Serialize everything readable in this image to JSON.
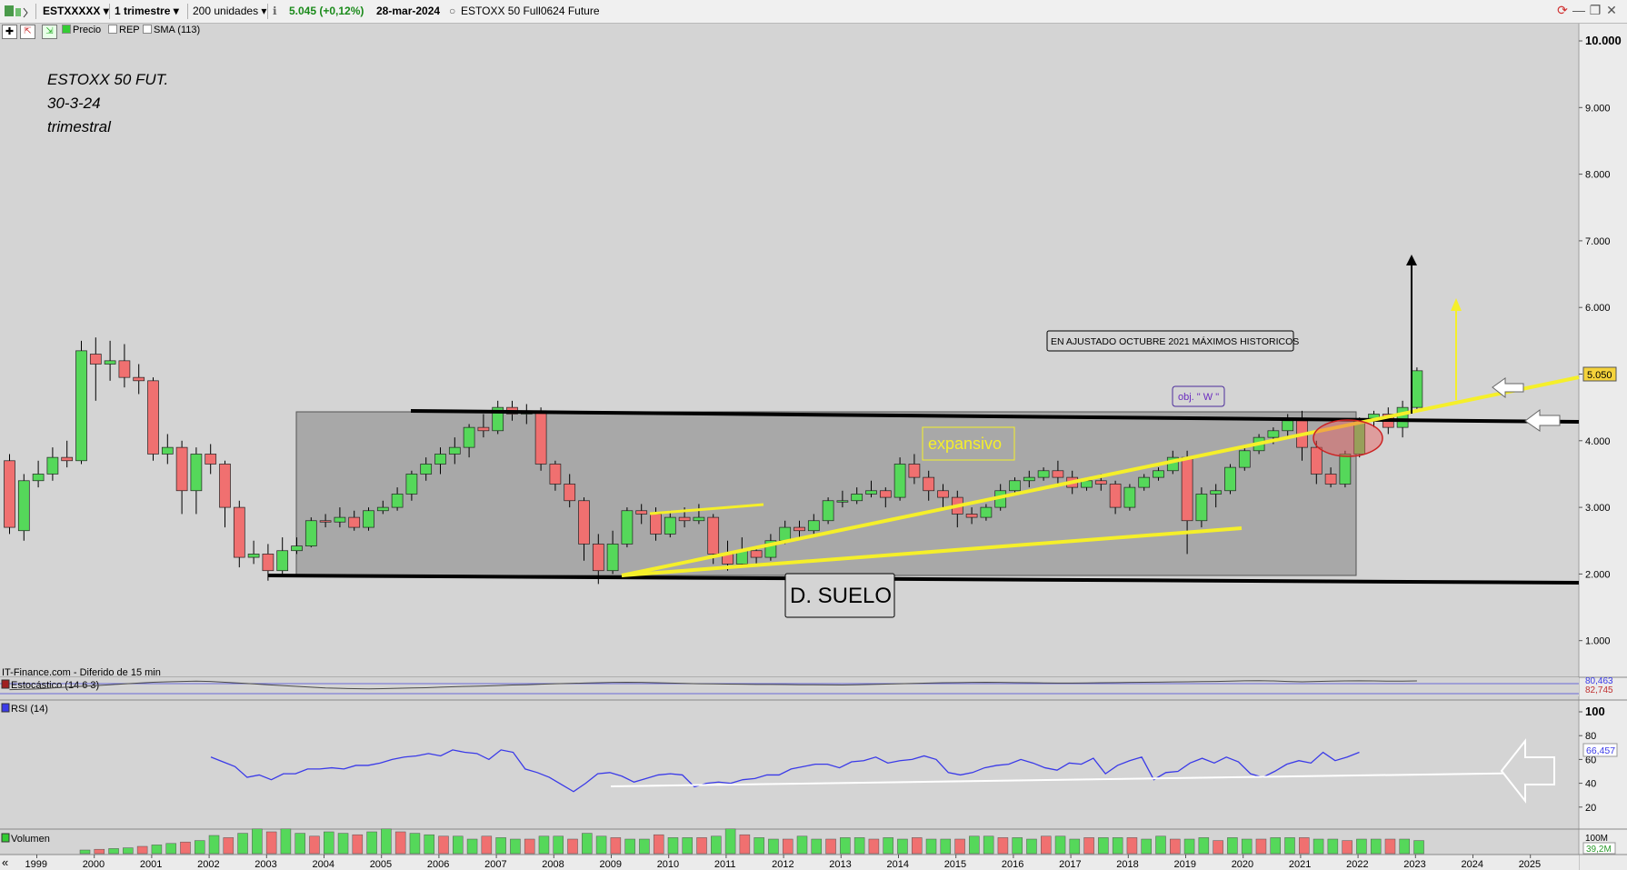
{
  "toolbar": {
    "symbol": "ESTXXXXX",
    "period": "1 trimestre",
    "units": "200 unidades",
    "info_icon": "info-icon",
    "quote": "5.045 (+0,12%)",
    "date": "28-mar-2024",
    "instrument": "ESTOXX 50 Full0624 Future",
    "refresh_icon": "refresh-icon",
    "minimize_icon": "minimize-icon",
    "restore_icon": "restore-icon",
    "close_icon": "close-icon"
  },
  "subbar": {
    "price_label": "Precio",
    "rep_label": "REP",
    "sma_label": "SMA (113)"
  },
  "annotation": {
    "line1": "ESTOXX 50 FUT.",
    "line2": "30-3-24",
    "line3": "trimestral"
  },
  "labels": {
    "maximos": "EN AJUSTADO OCTUBRE 2021 MÁXIMOS HISTORICOS",
    "obj_w": "obj. \" W \"",
    "expansivo": "expansivo",
    "suelo": "D. SUELO",
    "source": "IT-Finance.com - Diferido de 15 min",
    "last_price": "5.050",
    "stoch_label": "Estocástico (14 6 3)",
    "stoch_value": "82,745",
    "stoch_cut": "80,463",
    "rsi_label": "RSI (14)",
    "rsi_value": "66,457",
    "vol_label": "Volumen",
    "vol_max": "100M",
    "vol_value": "39,2M",
    "scroll_left": "«"
  },
  "colors": {
    "up": "#55d85a",
    "down": "#f07070",
    "yellow": "#f5ef2a",
    "rsi": "#3a3ae8"
  },
  "chart_data": {
    "type": "candlestick",
    "title": "ESTOXX 50 FUT.",
    "period": "quarterly",
    "ylim": [
      1000,
      10000
    ],
    "y_scale": "log",
    "y_ticks": [
      "10.000",
      "9.000",
      "8.000",
      "7.000",
      "6.000",
      "5.000",
      "4.000",
      "3.000",
      "2.000",
      "1.000"
    ],
    "x_ticks": [
      "1999",
      "2000",
      "2001",
      "2002",
      "2003",
      "2004",
      "2005",
      "2006",
      "2007",
      "2008",
      "2009",
      "2010",
      "2011",
      "2012",
      "2013",
      "2014",
      "2015",
      "2016",
      "2017",
      "2018",
      "2019",
      "2020",
      "2021",
      "2022",
      "2023",
      "2024",
      "2025"
    ],
    "candles": [
      [
        3700,
        2700,
        3800,
        2600
      ],
      [
        2650,
        3400,
        3500,
        2500
      ],
      [
        3400,
        3500,
        3700,
        3300
      ],
      [
        3500,
        3750,
        3900,
        3400
      ],
      [
        3750,
        3700,
        4000,
        3600
      ],
      [
        3700,
        5350,
        5500,
        3650
      ],
      [
        5300,
        5150,
        5550,
        4600
      ],
      [
        5150,
        5200,
        5500,
        4900
      ],
      [
        5200,
        4950,
        5450,
        4800
      ],
      [
        4950,
        4900,
        5150,
        4700
      ],
      [
        4900,
        3800,
        4950,
        3700
      ],
      [
        3800,
        3900,
        4100,
        3650
      ],
      [
        3900,
        3250,
        4000,
        2900
      ],
      [
        3250,
        3800,
        3900,
        2900
      ],
      [
        3800,
        3650,
        3950,
        3500
      ],
      [
        3650,
        3000,
        3700,
        2700
      ],
      [
        3000,
        2250,
        3100,
        2100
      ],
      [
        2250,
        2300,
        2500,
        2150
      ],
      [
        2300,
        2050,
        2450,
        1900
      ],
      [
        2050,
        2350,
        2550,
        2000
      ],
      [
        2350,
        2420,
        2550,
        2300
      ],
      [
        2420,
        2800,
        2850,
        2400
      ],
      [
        2800,
        2780,
        2900,
        2700
      ],
      [
        2780,
        2850,
        3000,
        2700
      ],
      [
        2850,
        2700,
        2950,
        2650
      ],
      [
        2700,
        2950,
        3000,
        2650
      ],
      [
        2950,
        3000,
        3100,
        2900
      ],
      [
        3000,
        3200,
        3300,
        2950
      ],
      [
        3200,
        3500,
        3550,
        3100
      ],
      [
        3500,
        3650,
        3750,
        3400
      ],
      [
        3650,
        3800,
        3900,
        3500
      ],
      [
        3800,
        3900,
        4050,
        3650
      ],
      [
        3900,
        4200,
        4250,
        3750
      ],
      [
        4200,
        4150,
        4400,
        4050
      ],
      [
        4150,
        4500,
        4600,
        4100
      ],
      [
        4500,
        4400,
        4600,
        4300
      ],
      [
        4400,
        4450,
        4550,
        4250
      ],
      [
        4450,
        3650,
        4500,
        3550
      ],
      [
        3650,
        3350,
        3700,
        3250
      ],
      [
        3350,
        3100,
        3500,
        3000
      ],
      [
        3100,
        2450,
        3150,
        2200
      ],
      [
        2450,
        2050,
        2600,
        1850
      ],
      [
        2050,
        2450,
        2650,
        2000
      ],
      [
        2450,
        2950,
        3000,
        2400
      ],
      [
        2950,
        2900,
        3050,
        2750
      ],
      [
        2900,
        2600,
        3000,
        2500
      ],
      [
        2600,
        2850,
        2950,
        2550
      ],
      [
        2850,
        2800,
        3000,
        2700
      ],
      [
        2800,
        2850,
        3050,
        2750
      ],
      [
        2850,
        2300,
        2900,
        2150
      ],
      [
        2300,
        2150,
        2500,
        2050
      ],
      [
        2150,
        2350,
        2550,
        2100
      ],
      [
        2350,
        2250,
        2400,
        2150
      ],
      [
        2250,
        2500,
        2600,
        2200
      ],
      [
        2500,
        2700,
        2800,
        2450
      ],
      [
        2700,
        2650,
        2800,
        2550
      ],
      [
        2650,
        2800,
        2900,
        2600
      ],
      [
        2800,
        3100,
        3150,
        2750
      ],
      [
        3100,
        3100,
        3250,
        3000
      ],
      [
        3100,
        3200,
        3300,
        3050
      ],
      [
        3200,
        3250,
        3400,
        3150
      ],
      [
        3250,
        3150,
        3300,
        3000
      ],
      [
        3150,
        3650,
        3750,
        3100
      ],
      [
        3650,
        3450,
        3800,
        3350
      ],
      [
        3450,
        3250,
        3550,
        3100
      ],
      [
        3250,
        3150,
        3350,
        3000
      ],
      [
        3150,
        2900,
        3250,
        2700
      ],
      [
        2900,
        2850,
        3000,
        2750
      ],
      [
        2850,
        3000,
        3050,
        2800
      ],
      [
        3000,
        3250,
        3350,
        2950
      ],
      [
        3250,
        3400,
        3450,
        3200
      ],
      [
        3400,
        3450,
        3550,
        3300
      ],
      [
        3450,
        3550,
        3600,
        3400
      ],
      [
        3550,
        3450,
        3700,
        3350
      ],
      [
        3450,
        3300,
        3550,
        3200
      ],
      [
        3300,
        3400,
        3450,
        3250
      ],
      [
        3400,
        3350,
        3500,
        3250
      ],
      [
        3350,
        3000,
        3400,
        2900
      ],
      [
        3000,
        3300,
        3350,
        2950
      ],
      [
        3300,
        3450,
        3500,
        3250
      ],
      [
        3450,
        3550,
        3600,
        3400
      ],
      [
        3550,
        3750,
        3850,
        3500
      ],
      [
        3750,
        2800,
        3850,
        2300
      ],
      [
        2800,
        3200,
        3300,
        2700
      ],
      [
        3200,
        3250,
        3350,
        3000
      ],
      [
        3250,
        3600,
        3650,
        3200
      ],
      [
        3600,
        3850,
        3900,
        3550
      ],
      [
        3850,
        4050,
        4100,
        3800
      ],
      [
        4050,
        4150,
        4200,
        3950
      ],
      [
        4150,
        4300,
        4400,
        4050
      ],
      [
        4300,
        3900,
        4450,
        3700
      ],
      [
        3900,
        3500,
        4000,
        3350
      ],
      [
        3500,
        3350,
        3600,
        3300
      ],
      [
        3350,
        3800,
        3850,
        3300
      ],
      [
        3800,
        4300,
        4350,
        3750
      ],
      [
        4300,
        4400,
        4450,
        4200
      ],
      [
        4400,
        4200,
        4500,
        4100
      ],
      [
        4200,
        4500,
        4600,
        4050
      ],
      [
        4500,
        5050,
        5100,
        4450
      ]
    ],
    "stochastic": [
      30,
      32,
      35,
      40,
      45,
      50,
      55,
      60,
      65,
      70,
      75,
      78,
      80,
      82,
      80,
      75,
      70,
      65,
      60,
      55,
      50,
      45,
      40,
      38,
      36,
      35,
      36,
      38,
      40,
      42,
      45,
      48,
      50,
      52,
      55,
      58,
      60,
      63,
      66,
      68,
      70,
      72,
      74,
      75,
      74,
      72,
      70,
      68,
      66,
      65,
      64,
      63,
      62,
      62,
      61,
      60,
      60,
      59,
      58,
      60,
      62,
      64,
      66,
      68,
      70,
      72,
      73,
      74,
      75,
      74,
      73,
      72,
      71,
      70,
      70,
      71,
      72,
      73,
      74,
      75,
      76,
      77,
      78,
      79,
      80,
      82,
      84,
      85,
      83,
      80,
      78,
      80,
      82,
      83,
      84,
      83,
      82,
      82,
      83
    ],
    "rsi": [
      62,
      58,
      54,
      45,
      47,
      43,
      48,
      48,
      52,
      52,
      53,
      52,
      55,
      55,
      57,
      60,
      62,
      63,
      65,
      63,
      68,
      66,
      65,
      60,
      68,
      66,
      52,
      49,
      45,
      39,
      33,
      40,
      48,
      49,
      46,
      41,
      44,
      47,
      48,
      47,
      37,
      40,
      41,
      40,
      43,
      44,
      47,
      47,
      52,
      54,
      56,
      56,
      53,
      58,
      59,
      62,
      57,
      59,
      60,
      63,
      60,
      49,
      47,
      49,
      53,
      55,
      56,
      60,
      57,
      53,
      51,
      57,
      56,
      61,
      48,
      55,
      59,
      62,
      43,
      49,
      50,
      57,
      61,
      57,
      62,
      58,
      48,
      45,
      50,
      56,
      59,
      57,
      66,
      59,
      62,
      66
    ],
    "volume": [
      5,
      6,
      7,
      8,
      10,
      12,
      14,
      16,
      18,
      25,
      22,
      28,
      34,
      30,
      34,
      28,
      24,
      30,
      28,
      26,
      30,
      34,
      30,
      28,
      26,
      24,
      24,
      20,
      24,
      22,
      20,
      20,
      24,
      24,
      20,
      28,
      24,
      22,
      20,
      20,
      26,
      22,
      22,
      22,
      24,
      34,
      26,
      22,
      20,
      20,
      24,
      20,
      20,
      22,
      22,
      20,
      22,
      20,
      22,
      20,
      20,
      20,
      24,
      24,
      22,
      22,
      20,
      24,
      24,
      20,
      22,
      22,
      22,
      22,
      20,
      24,
      20,
      20,
      22,
      18,
      22,
      20,
      20,
      22,
      22,
      22,
      20,
      20,
      18,
      20,
      20,
      20,
      20,
      18
    ]
  }
}
